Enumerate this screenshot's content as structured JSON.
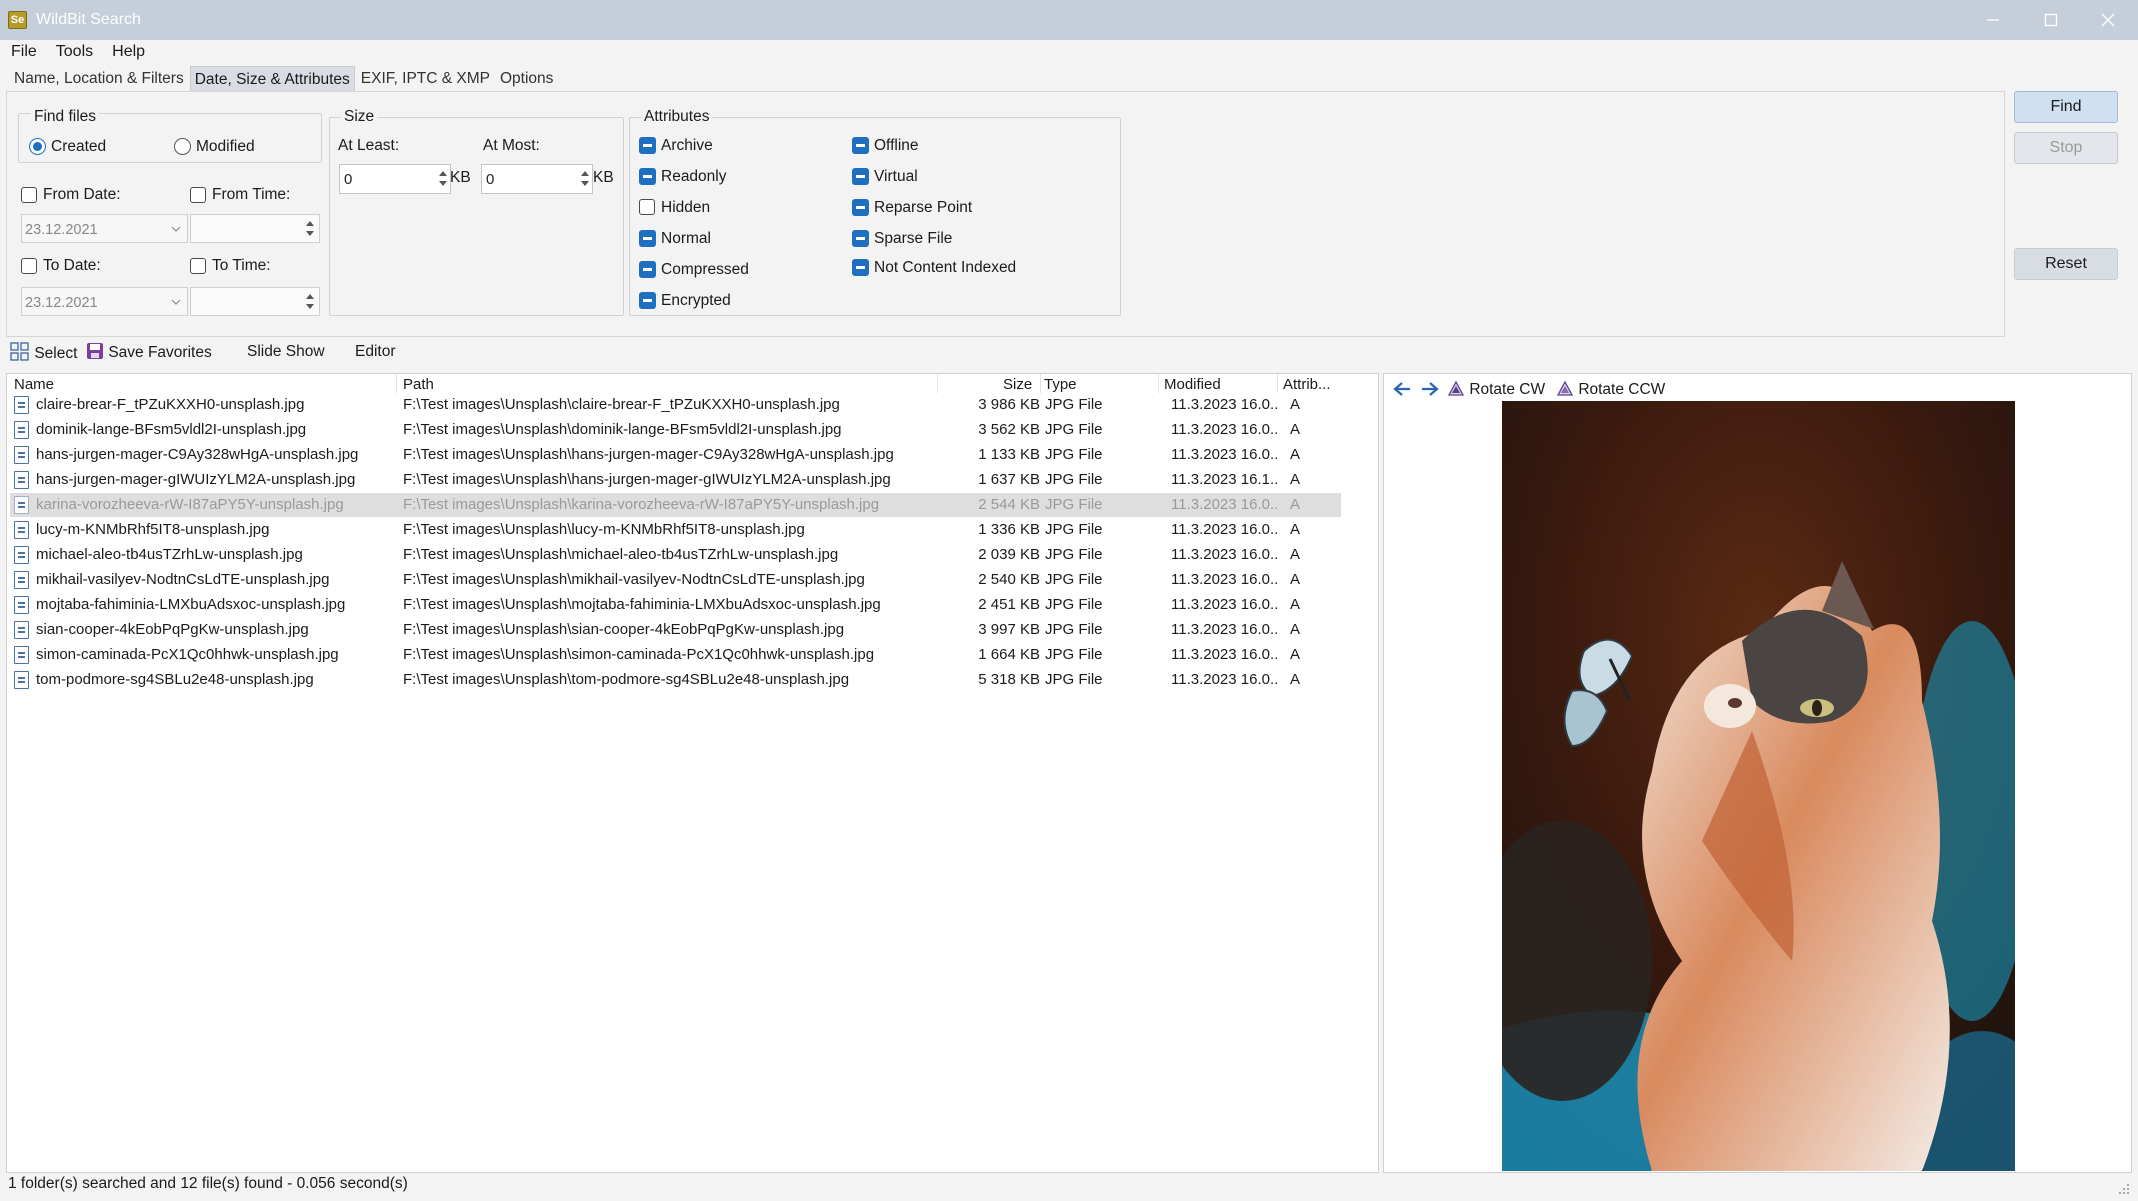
{
  "window": {
    "title": "WildBit Search",
    "icon_text": "Se"
  },
  "menu": [
    "File",
    "Tools",
    "Help"
  ],
  "tabs": [
    "Name, Location & Filters",
    "Date, Size & Attributes",
    "EXIF, IPTC & XMP",
    "Options"
  ],
  "active_tab": 1,
  "find_files": {
    "title": "Find files",
    "created": "Created",
    "modified": "Modified",
    "selected": "Created",
    "from_date": "From Date:",
    "from_time": "From Time:",
    "to_date": "To Date:",
    "to_time": "To Time:",
    "from_date_value": "23.12.2021",
    "to_date_value": "23.12.2021"
  },
  "size": {
    "title": "Size",
    "at_least": "At Least:",
    "at_most": "At Most:",
    "min_value": "0",
    "max_value": "0",
    "unit": "KB"
  },
  "attributes": {
    "title": "Attributes",
    "left": [
      {
        "label": "Archive",
        "state": "indeterminate"
      },
      {
        "label": "Readonly",
        "state": "indeterminate"
      },
      {
        "label": "Hidden",
        "state": "unchecked"
      },
      {
        "label": "Normal",
        "state": "indeterminate"
      },
      {
        "label": "Compressed",
        "state": "indeterminate"
      },
      {
        "label": "Encrypted",
        "state": "indeterminate"
      }
    ],
    "right": [
      {
        "label": "Offline",
        "state": "indeterminate"
      },
      {
        "label": "Virtual",
        "state": "indeterminate"
      },
      {
        "label": "Reparse Point",
        "state": "indeterminate"
      },
      {
        "label": "Sparse File",
        "state": "indeterminate"
      },
      {
        "label": "Not Content Indexed",
        "state": "indeterminate"
      }
    ]
  },
  "buttons": {
    "find": "Find",
    "stop": "Stop",
    "reset": "Reset"
  },
  "toolbar": {
    "select": "Select",
    "save_favorites": "Save Favorites",
    "slide_show": "Slide Show",
    "editor": "Editor"
  },
  "columns": {
    "name": "Name",
    "path": "Path",
    "size": "Size",
    "type": "Type",
    "modified": "Modified",
    "attrib": "Attrib..."
  },
  "files": [
    {
      "name": "claire-brear-F_tPZuKXXH0-unsplash.jpg",
      "path": "F:\\Test images\\Unsplash\\claire-brear-F_tPZuKXXH0-unsplash.jpg",
      "size": "3 986 KB",
      "type": "JPG File",
      "modified": "11.3.2023 16.0...",
      "attrib": "A"
    },
    {
      "name": "dominik-lange-BFsm5vldl2I-unsplash.jpg",
      "path": "F:\\Test images\\Unsplash\\dominik-lange-BFsm5vldl2I-unsplash.jpg",
      "size": "3 562 KB",
      "type": "JPG File",
      "modified": "11.3.2023 16.0...",
      "attrib": "A"
    },
    {
      "name": "hans-jurgen-mager-C9Ay328wHgA-unsplash.jpg",
      "path": "F:\\Test images\\Unsplash\\hans-jurgen-mager-C9Ay328wHgA-unsplash.jpg",
      "size": "1 133 KB",
      "type": "JPG File",
      "modified": "11.3.2023 16.0...",
      "attrib": "A"
    },
    {
      "name": "hans-jurgen-mager-gIWUIzYLM2A-unsplash.jpg",
      "path": "F:\\Test images\\Unsplash\\hans-jurgen-mager-gIWUIzYLM2A-unsplash.jpg",
      "size": "1 637 KB",
      "type": "JPG File",
      "modified": "11.3.2023 16.1...",
      "attrib": "A"
    },
    {
      "name": "karina-vorozheeva-rW-I87aPY5Y-unsplash.jpg",
      "path": "F:\\Test images\\Unsplash\\karina-vorozheeva-rW-I87aPY5Y-unsplash.jpg",
      "size": "2 544 KB",
      "type": "JPG File",
      "modified": "11.3.2023 16.0...",
      "attrib": "A",
      "selected": true
    },
    {
      "name": "lucy-m-KNMbRhf5IT8-unsplash.jpg",
      "path": "F:\\Test images\\Unsplash\\lucy-m-KNMbRhf5IT8-unsplash.jpg",
      "size": "1 336 KB",
      "type": "JPG File",
      "modified": "11.3.2023 16.0...",
      "attrib": "A"
    },
    {
      "name": "michael-aleo-tb4usTZrhLw-unsplash.jpg",
      "path": "F:\\Test images\\Unsplash\\michael-aleo-tb4usTZrhLw-unsplash.jpg",
      "size": "2 039 KB",
      "type": "JPG File",
      "modified": "11.3.2023 16.0...",
      "attrib": "A"
    },
    {
      "name": "mikhail-vasilyev-NodtnCsLdTE-unsplash.jpg",
      "path": "F:\\Test images\\Unsplash\\mikhail-vasilyev-NodtnCsLdTE-unsplash.jpg",
      "size": "2 540 KB",
      "type": "JPG File",
      "modified": "11.3.2023 16.0...",
      "attrib": "A"
    },
    {
      "name": "mojtaba-fahiminia-LMXbuAdsxoc-unsplash.jpg",
      "path": "F:\\Test images\\Unsplash\\mojtaba-fahiminia-LMXbuAdsxoc-unsplash.jpg",
      "size": "2 451 KB",
      "type": "JPG File",
      "modified": "11.3.2023 16.0...",
      "attrib": "A"
    },
    {
      "name": "sian-cooper-4kEobPqPgKw-unsplash.jpg",
      "path": "F:\\Test images\\Unsplash\\sian-cooper-4kEobPqPgKw-unsplash.jpg",
      "size": "3 997 KB",
      "type": "JPG File",
      "modified": "11.3.2023 16.0...",
      "attrib": "A"
    },
    {
      "name": "simon-caminada-PcX1Qc0hhwk-unsplash.jpg",
      "path": "F:\\Test images\\Unsplash\\simon-caminada-PcX1Qc0hhwk-unsplash.jpg",
      "size": "1 664 KB",
      "type": "JPG File",
      "modified": "11.3.2023 16.0...",
      "attrib": "A"
    },
    {
      "name": "tom-podmore-sg4SBLu2e48-unsplash.jpg",
      "path": "F:\\Test images\\Unsplash\\tom-podmore-sg4SBLu2e48-unsplash.jpg",
      "size": "5 318 KB",
      "type": "JPG File",
      "modified": "11.3.2023 16.0...",
      "attrib": "A"
    }
  ],
  "preview": {
    "rotate_cw": "Rotate CW",
    "rotate_ccw": "Rotate CCW",
    "prev_icon": "arrow-left-icon",
    "next_icon": "arrow-right-icon"
  },
  "status": "1 folder(s) searched and 12 file(s) found - 0.056 second(s)",
  "colors": {
    "accent": "#1e6fbf",
    "titlebar": "#c5ced9",
    "selected_row": "#dedede"
  }
}
